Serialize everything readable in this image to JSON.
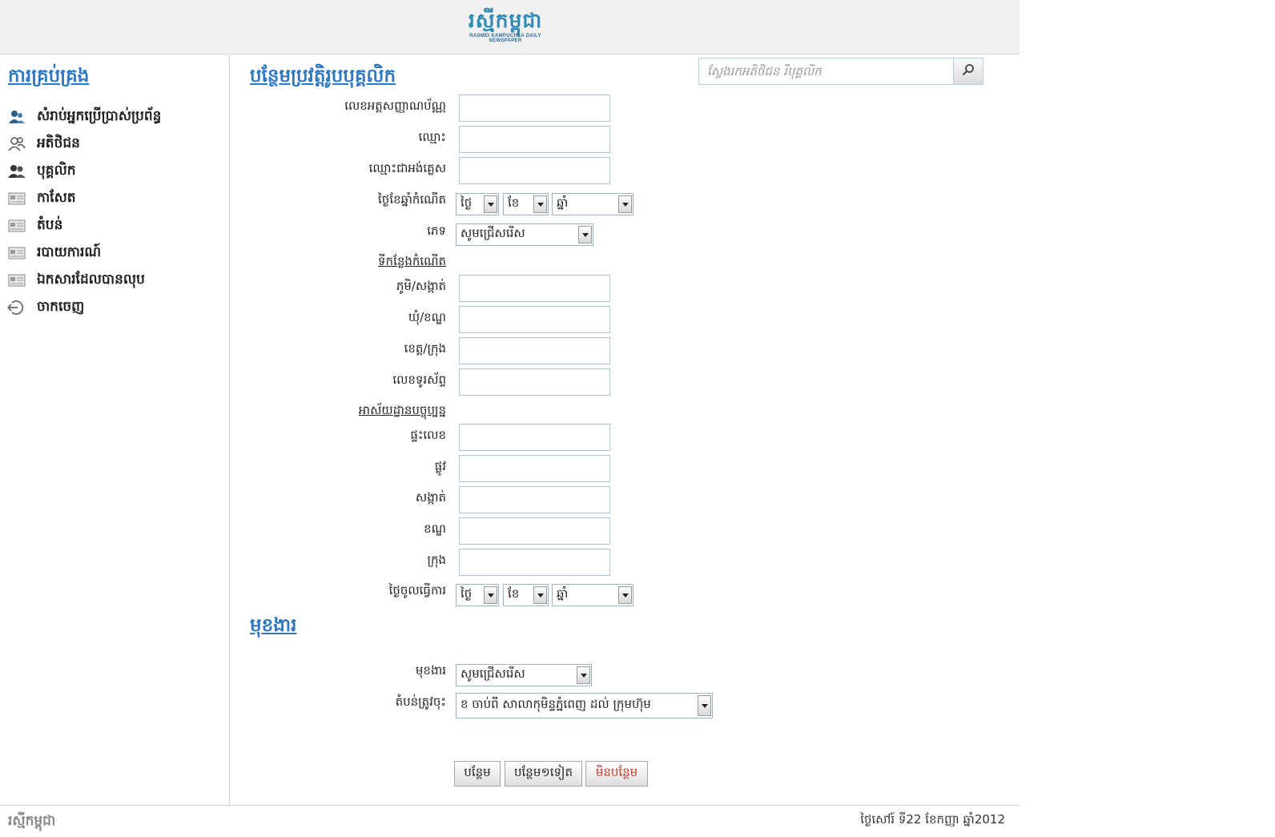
{
  "header": {
    "logo_main": "រស្មីកម្ពុជា",
    "logo_tag": "RASMEI KAMPUCHEA DAILY NEWSPAPER"
  },
  "sidebar": {
    "title": "ការគ្រប់គ្រង",
    "items": [
      {
        "label": "សំរាប់អ្នកប្រើប្រាស់ប្រព័ន្ធ",
        "icon": "user-admin-icon"
      },
      {
        "label": "អតិថិជន",
        "icon": "customers-icon"
      },
      {
        "label": "បុគ្គលិក",
        "icon": "staff-icon"
      },
      {
        "label": "កាសែត",
        "icon": "newspaper-icon"
      },
      {
        "label": "តំបន់",
        "icon": "area-icon"
      },
      {
        "label": "របាយការណ៍",
        "icon": "report-icon"
      },
      {
        "label": "ឯកសារដែលបានលុប",
        "icon": "deleted-docs-icon"
      },
      {
        "label": "ចាកចេញ",
        "icon": "logout-icon"
      }
    ]
  },
  "search": {
    "placeholder": "ស្វែងរកអតិថិជន រឺបុគ្គលិក"
  },
  "form": {
    "title": "បន្ថែមប្រវត្តិរូបបុគ្គលិក",
    "id_card_label": "លេខអត្តសញ្ញាណប័ណ្ណ",
    "name_label": "ឈ្មោះ",
    "latin_name_label": "ឈ្មោះជាអង់គ្លេស",
    "dob_label": "ថ្ងៃខែឆ្នាំកំណើត",
    "dob_day": "ថ្ងៃ",
    "dob_month": "ខែ",
    "dob_year": "ឆ្នាំ",
    "gender_label": "ភេទ",
    "gender_value": "សូមជ្រើសរើស",
    "birthplace_heading": "ទីកន្លែងកំណើត",
    "village_label": "ភូមិ/សង្កាត់",
    "commune_label": "ឃុំ/ខណ្ឌ",
    "province_label": "ខេត្ត/ក្រុង",
    "phone_label": "លេខទូរស័ព្ទ",
    "address_heading": "អាស័យដ្ឋានបច្ចុប្បន្ន",
    "house_label": "ផ្ទះលេខ",
    "street_label": "ផ្លូវ",
    "sangkat_label": "សង្កាត់",
    "khan_label": "ខណ្ឌ",
    "city_label": "ក្រុង",
    "start_date_label": "ថ្ងៃចូលធ្វើការ",
    "start_day": "ថ្ងៃ",
    "start_month": "ខែ",
    "start_year": "ឆ្នាំ"
  },
  "job": {
    "title": "មុខងារ",
    "position_label": "មុខងារ",
    "position_value": "សូមជ្រើសរើស",
    "area_label": "តំបន់ត្រូវចុះ",
    "area_value": "ខ ចាប់ពី សាលាកុមិន្ទភ្នំពេញ ដល់ ក្រុមហ៊ុម"
  },
  "buttons": {
    "add": "បន្ថែម",
    "add_another": "បន្ថែម១ទៀត",
    "cancel": "មិនបន្ថែម"
  },
  "footer": {
    "logo": "រស្មីកម្ពុជា",
    "date": "ថ្ងៃសៅរ៍ ទី22 ខែកញ្ញា ឆ្នាំ2012"
  },
  "colors": {
    "accent": "#2f78c0",
    "header_bg": "#f0f0f0",
    "cancel_text": "#c0392b"
  }
}
